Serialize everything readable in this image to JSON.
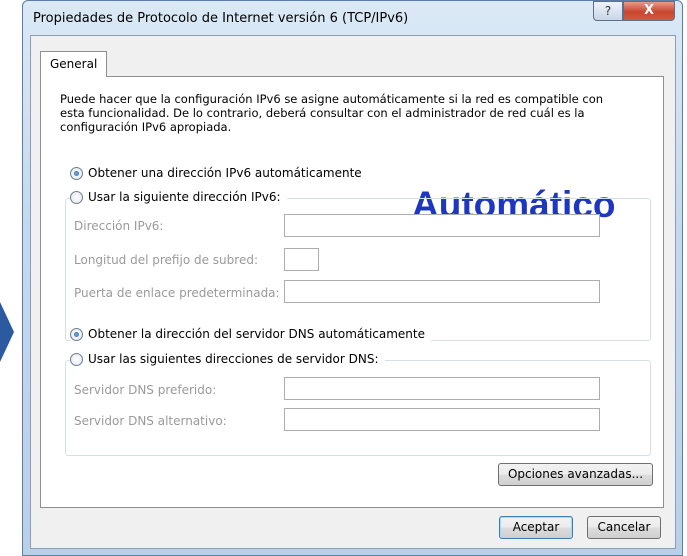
{
  "window": {
    "title": "Propiedades de Protocolo de Internet versión 6 (TCP/IPv6)",
    "help_label": "?",
    "close_label": "X"
  },
  "tabs": [
    {
      "label": "General"
    }
  ],
  "description": "Puede hacer que la configuración IPv6 se asigne automáticamente si la red es compatible con esta funcionalidad. De lo contrario, deberá consultar con el administrador de red cuál es la configuración IPv6 apropiada.",
  "overlay_text": "Automático",
  "ip_section": {
    "auto_option": {
      "label": "Obtener una dirección IPv6 automáticamente",
      "selected": true
    },
    "manual_option": {
      "label": "Usar la siguiente dirección IPv6:",
      "selected": false
    },
    "fields": [
      {
        "label": "Dirección IPv6:",
        "value": ""
      },
      {
        "label": "Longitud del prefijo de subred:",
        "value": ""
      },
      {
        "label": "Puerta de enlace predeterminada:",
        "value": ""
      }
    ]
  },
  "dns_section": {
    "auto_option": {
      "label": "Obtener la dirección del servidor DNS automáticamente",
      "selected": true
    },
    "manual_option": {
      "label": "Usar las siguientes direcciones de servidor DNS:",
      "selected": false
    },
    "fields": [
      {
        "label": "Servidor DNS preferido:",
        "value": ""
      },
      {
        "label": "Servidor DNS alternativo:",
        "value": ""
      }
    ]
  },
  "buttons": {
    "advanced": "Opciones avanzadas...",
    "accept": "Aceptar",
    "cancel": "Cancelar"
  },
  "colors": {
    "overlay_text": "#1f36c0",
    "arrow": "#2b5aa0",
    "disabled_label": "#9a9a9a"
  },
  "icons": {
    "left_arrow": "chevron-right-icon"
  }
}
